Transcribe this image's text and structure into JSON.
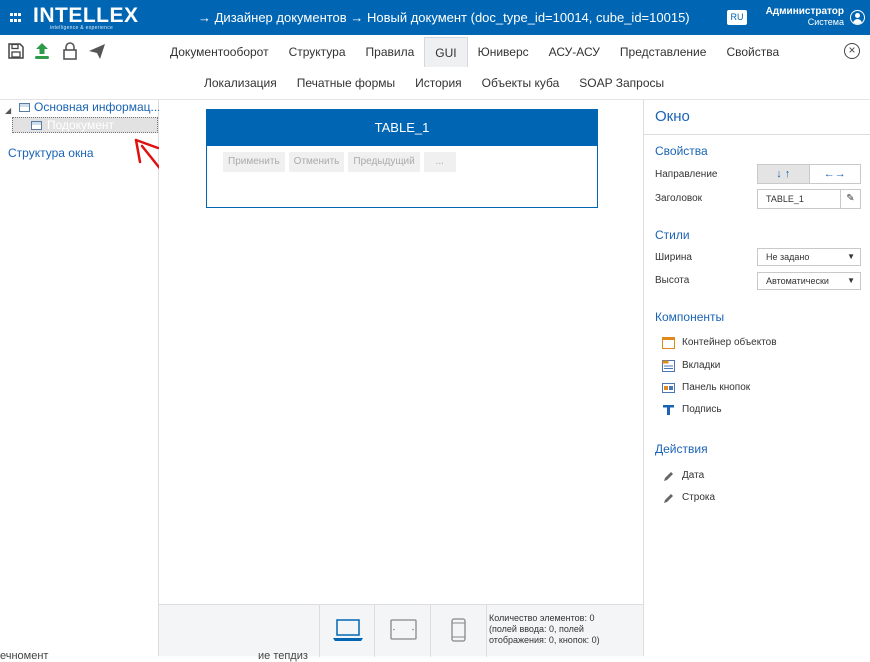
{
  "app": {
    "logo": "INTELLEX",
    "tagline": "intelligence & experience"
  },
  "breadcrumb": {
    "arrow1": "→",
    "item1": "Дизайнер документов",
    "arrow2": "→",
    "item2": "Новый документ (doc_type_id=10014, cube_id=10015)"
  },
  "language": "RU",
  "user": {
    "name": "Администратор",
    "role": "Система"
  },
  "toolbar": {
    "icons": [
      "save-icon",
      "upload-icon",
      "lock-icon",
      "send-icon"
    ]
  },
  "tabs_primary": [
    "Документооборот",
    "Структура",
    "Правила",
    "GUI",
    "Юниверс",
    "АСУ-АСУ",
    "Представление",
    "Свойства"
  ],
  "active_tab": "GUI",
  "tabs_secondary": [
    "Локализация",
    "Печатные формы",
    "История",
    "Объекты куба",
    "SOAP Запросы"
  ],
  "tree": {
    "root": "Основная информац...",
    "child": "Подокумент",
    "structure_link": "Структура окна"
  },
  "widget": {
    "title": "TABLE_1",
    "buttons": [
      "Применить",
      "Отменить",
      "Предыдущий",
      "..."
    ]
  },
  "bottom": {
    "line1": "Количество элементов: 0",
    "line2": "(полей ввода: 0, полей",
    "line3": "отображения: 0, кнопок: 0)"
  },
  "panel": {
    "title": "Окно",
    "props_section": "Свойства",
    "direction_label": "Направление",
    "direction_vertical": "↓ ↑",
    "direction_horizontal": "←→",
    "caption_label": "Заголовок",
    "caption_value": "TABLE_1",
    "styles_section": "Стили",
    "width_label": "Ширина",
    "width_value": "Не задано",
    "height_label": "Высота",
    "height_value": "Автоматически",
    "components_section": "Компоненты",
    "components": [
      "Контейнер объектов",
      "Вкладки",
      "Панель кнопок",
      "Подпись"
    ],
    "actions_section": "Действия",
    "actions": [
      "Дата",
      "Строка"
    ]
  },
  "clipped": {
    "left": "ечномент",
    "mid": "ие тепдиз"
  },
  "colors": {
    "brand": "#0066b3",
    "link": "#1a63b5",
    "panel_bg": "#f4f5f7"
  }
}
